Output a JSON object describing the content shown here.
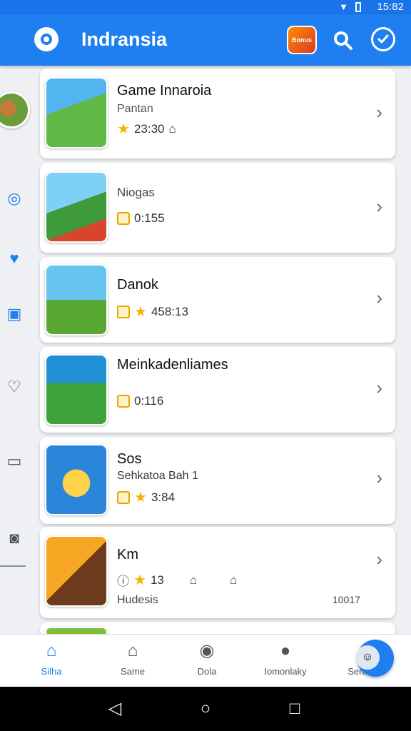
{
  "status": {
    "time": "15:82"
  },
  "app": {
    "title": "Indransia",
    "thumb_label": "Bonus"
  },
  "games": [
    {
      "name": "Game Innaroia",
      "subtitle": "Pantan",
      "meta": "23:30"
    },
    {
      "name": "Niogas",
      "subtitle": "",
      "meta": "0:155"
    },
    {
      "name": "Danok",
      "subtitle": "",
      "meta": "458:13"
    },
    {
      "name": "Meinkadenliames",
      "subtitle": "",
      "meta": "0:116"
    },
    {
      "name": "Sos",
      "subtitle": "Sehkatoa Bah 1",
      "meta": "3:84"
    },
    {
      "name": "Km",
      "subtitle": "",
      "meta": "13",
      "extra": "Hudesis",
      "right_value": "10017"
    }
  ],
  "bottom_nav": [
    {
      "label": "Silha",
      "icon": "home-icon"
    },
    {
      "label": "Same",
      "icon": "house-icon"
    },
    {
      "label": "Dola",
      "icon": "gamepad-icon"
    },
    {
      "label": "Iomonlaky",
      "icon": "person-icon"
    },
    {
      "label": "Sertes",
      "icon": "chat-icon"
    }
  ],
  "colors": {
    "primary": "#1f7ff0",
    "star": "#f5b301"
  }
}
